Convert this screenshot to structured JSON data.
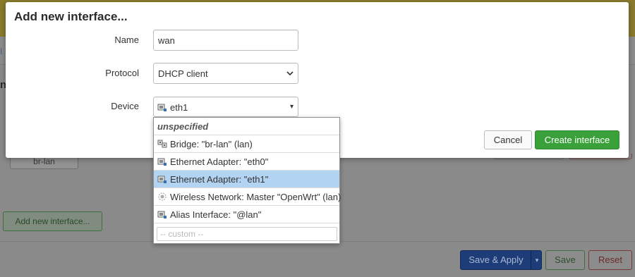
{
  "background": {
    "left_link_text": "I",
    "left_heading_text": "n",
    "bridge_button": "br-lan",
    "add_interface_button": "Add new interface...",
    "save_apply_button": "Save & Apply",
    "save_apply_arrow": "▾",
    "save_button": "Save",
    "reset_button": "Reset"
  },
  "modal": {
    "title": "Add new interface...",
    "name_label": "Name",
    "name_value": "wan",
    "protocol_label": "Protocol",
    "protocol_value": "DHCP client",
    "device_label": "Device",
    "device_value": "eth1",
    "device_arrow": "▾",
    "cancel_button": "Cancel",
    "create_button": "Create interface"
  },
  "device_dropdown": {
    "unspecified_label": "unspecified",
    "items": [
      {
        "label": "Bridge: \"br-lan\" (lan)",
        "icon": "bridge-icon",
        "selected": false
      },
      {
        "label": "Ethernet Adapter: \"eth0\"",
        "icon": "ethernet-icon",
        "selected": false
      },
      {
        "label": "Ethernet Adapter: \"eth1\"",
        "icon": "ethernet-icon",
        "selected": true
      },
      {
        "label": "Wireless Network: Master \"OpenWrt\" (lan)",
        "icon": "wireless-icon",
        "selected": false
      },
      {
        "label": "Alias Interface: \"@lan\"",
        "icon": "alias-icon",
        "selected": false
      }
    ],
    "custom_placeholder": "-- custom --"
  },
  "colors": {
    "primary_green": "#3aa13a",
    "selected_row": "#b3d3f3",
    "overlay_gray": "#8a8a8a"
  }
}
